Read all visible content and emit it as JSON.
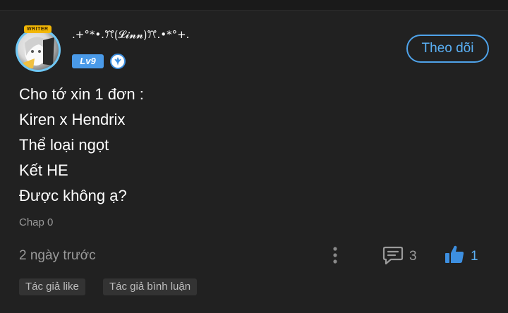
{
  "comment": {
    "author": {
      "name": ".+°*•.ꔫ⟮𝓛𝓲𝓷𝓷⟯ꔫ.•*°+.",
      "writer_badge": "WRITER",
      "level": "Lv9"
    },
    "follow_label": "Theo dõi",
    "lines": [
      "Cho tớ xin 1 đơn :",
      "Kiren x Hendrix",
      "Thể loại ngọt",
      "Kết HE",
      "Được không ạ?"
    ],
    "chapter": "Chap 0",
    "time": "2 ngày trước",
    "reply_count": "3",
    "like_count": "1",
    "tags": [
      "Tác giả like",
      "Tác giả bình luận"
    ]
  },
  "colors": {
    "background": "#212121",
    "accent": "#4fa3ea",
    "muted_text": "#9a9a9a",
    "tag_bg": "#333333"
  },
  "icons": [
    "avatar",
    "role-badge-icon",
    "more-vertical-icon",
    "comment-icon",
    "thumbs-up-icon"
  ]
}
